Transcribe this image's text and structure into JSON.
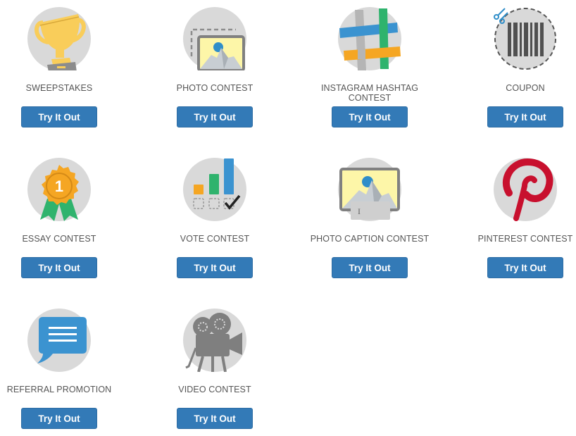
{
  "button_color": "#337ab7",
  "cards": [
    {
      "label": "SWEEPSTAKES",
      "icon": "trophy-icon",
      "button": "Try It Out"
    },
    {
      "label": "PHOTO CONTEST",
      "icon": "photo-icon",
      "button": "Try It Out"
    },
    {
      "label": "INSTAGRAM HASHTAG CONTEST",
      "icon": "hashtag-icon",
      "button": "Try It Out"
    },
    {
      "label": "COUPON",
      "icon": "coupon-barcode-icon",
      "button": "Try It Out"
    },
    {
      "label": "ESSAY CONTEST",
      "icon": "award-ribbon-icon",
      "button": "Try It Out"
    },
    {
      "label": "VOTE CONTEST",
      "icon": "vote-bar-chart-icon",
      "button": "Try It Out"
    },
    {
      "label": "PHOTO CAPTION CONTEST",
      "icon": "photo-caption-icon",
      "button": "Try It Out"
    },
    {
      "label": "PINTEREST CONTEST",
      "icon": "pinterest-icon",
      "button": "Try It Out"
    },
    {
      "label": "REFERRAL PROMOTION",
      "icon": "speech-bubble-icon",
      "button": "Try It Out"
    },
    {
      "label": "VIDEO CONTEST",
      "icon": "film-camera-icon",
      "button": "Try It Out"
    }
  ],
  "award_number": "1"
}
